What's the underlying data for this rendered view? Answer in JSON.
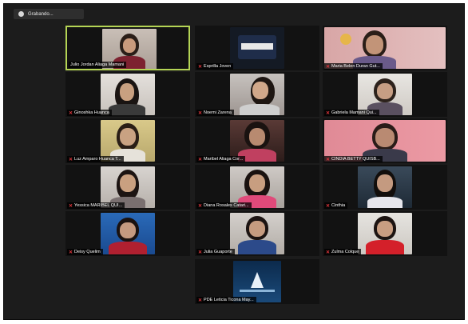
{
  "recording": {
    "label": "Grabando..."
  },
  "participants": [
    {
      "name": "Julio Jordan Aliaga Mamani",
      "muted": false,
      "active": true
    },
    {
      "name": "Esprilla Joven",
      "muted": true,
      "active": false
    },
    {
      "name": "Maria Belen Duran Gut...",
      "muted": true,
      "active": false
    },
    {
      "name": "Ginoshka Huanca",
      "muted": true,
      "active": false
    },
    {
      "name": "Noemi Zarena",
      "muted": true,
      "active": false
    },
    {
      "name": "Gabriela Mamani Qui...",
      "muted": true,
      "active": false
    },
    {
      "name": "Luz Amparo Huanca T...",
      "muted": true,
      "active": false
    },
    {
      "name": "Maribel Aliaga Cor...",
      "muted": true,
      "active": false
    },
    {
      "name": "CINDIA BETTY QUISB...",
      "muted": true,
      "active": false
    },
    {
      "name": "Yessica MARIBEL QUI...",
      "muted": true,
      "active": false
    },
    {
      "name": "Diana Rosales Catari...",
      "muted": true,
      "active": false
    },
    {
      "name": "Cinthia",
      "muted": true,
      "active": false
    },
    {
      "name": "Deisy Quelim",
      "muted": true,
      "active": false
    },
    {
      "name": "Julia Guaporte",
      "muted": true,
      "active": false
    },
    {
      "name": "Zulma Colque",
      "muted": true,
      "active": false
    },
    {
      "name": "PDE Leticia Ticona May...",
      "muted": true,
      "active": false
    }
  ],
  "icons": {
    "mic_muted": "mic-muted-icon",
    "record": "record-icon"
  },
  "colors": {
    "active_speaker_border": "#b4d455",
    "muted_icon": "#e0353b",
    "background": "#1c1c1c"
  }
}
